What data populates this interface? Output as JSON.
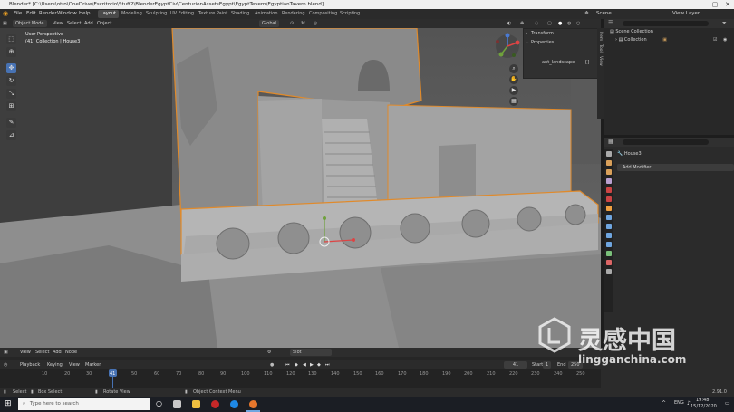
{
  "window": {
    "title": "Blender* [C:\\Users\\otro\\OneDrive\\Escritorio\\Stuff2\\BlenderEgyptCiv\\CenturionAssetsEgypt\\EgyptTevern\\EgyptianTavern.blend]",
    "minimize": "—",
    "maximize": "▢",
    "close": "✕"
  },
  "menu": {
    "items": [
      "File",
      "Edit",
      "Render",
      "Window",
      "Help"
    ],
    "workspaces": [
      "Layout",
      "Modeling",
      "Sculpting",
      "UV Editing",
      "Texture Paint",
      "Shading",
      "Animation",
      "Rendering",
      "Compositing",
      "Scripting"
    ],
    "active_workspace": "Layout",
    "scene_label": "Scene",
    "view_layer_label": "View Layer"
  },
  "viewport_header": {
    "mode": "Object Mode",
    "view": "View",
    "select": "Select",
    "add": "Add",
    "object": "Object",
    "transform_orientation": "Global"
  },
  "viewport": {
    "info_line1": "User Perspective",
    "info_line2": "(41) Collection | House3"
  },
  "n_panel": {
    "transform": "Transform",
    "properties": "Properties",
    "prop_name": "ant_landscape",
    "prop_value": "{}"
  },
  "side_tabs": [
    "Item",
    "Tool",
    "View"
  ],
  "outliner": {
    "root": "Scene Collection",
    "collection": "Collection"
  },
  "properties": {
    "object_name": "House3",
    "add_modifier": "Add Modifier"
  },
  "timeline_header": {
    "view": "View",
    "select": "Select",
    "add": "Add",
    "node": "Node",
    "slot": "Slot"
  },
  "playback": {
    "playback": "Playback",
    "keying": "Keying",
    "view": "View",
    "marker": "Marker",
    "current_frame": "41",
    "start_label": "Start",
    "start": "1",
    "end_label": "End",
    "end": "250"
  },
  "ruler_ticks": [
    "10",
    "20",
    "30",
    "41",
    "50",
    "60",
    "70",
    "80",
    "90",
    "100",
    "110",
    "120",
    "130",
    "140",
    "150",
    "160",
    "170",
    "180",
    "190",
    "200",
    "210",
    "220",
    "230",
    "240",
    "250"
  ],
  "status_bar": {
    "select": "Select",
    "box_select": "Box Select",
    "rotate_view": "Rotate View",
    "context_menu": "Object Context Menu",
    "version": "2.91.0"
  },
  "taskbar": {
    "search_placeholder": "Type here to search",
    "lang": "ENG",
    "time": "19:48",
    "date": "15/12/2020"
  },
  "watermark": {
    "cn_text": "灵感中国",
    "url": "lingganchina.com"
  },
  "colors": {
    "accent": "#4772b3",
    "selection_outline": "#e08a2b",
    "viewport_bg": "#5f5f5f"
  }
}
